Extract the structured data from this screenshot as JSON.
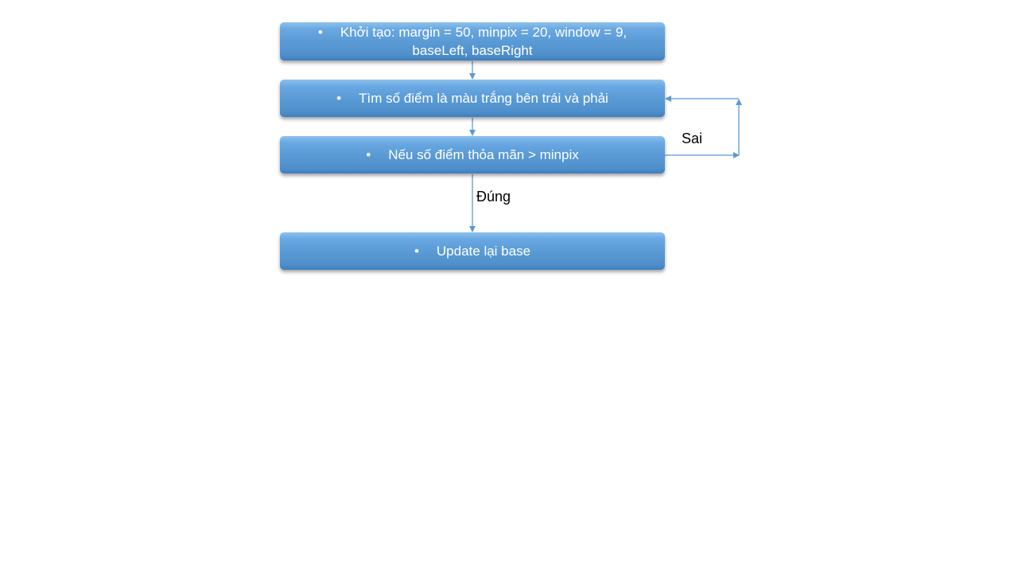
{
  "nodes": {
    "init": {
      "bullet": "•",
      "line1": "Khởi tạo: margin  = 50, minpix = 20, window = 9,",
      "line2": "baseLeft, baseRight"
    },
    "count": {
      "bullet": "•",
      "text": "Tìm số điểm là màu trắng bên trái và phải"
    },
    "check": {
      "bullet": "•",
      "text": "Nếu số điểm thỏa mãn > minpix"
    },
    "update": {
      "bullet": "•",
      "text": "Update lại base"
    }
  },
  "edges": {
    "false_label": "Sai",
    "true_label": "Đúng"
  },
  "colors": {
    "box_fill": "#5b9bd5",
    "connector": "#5b9bd5",
    "box_text": "#ffffff",
    "label_text": "#000000"
  }
}
